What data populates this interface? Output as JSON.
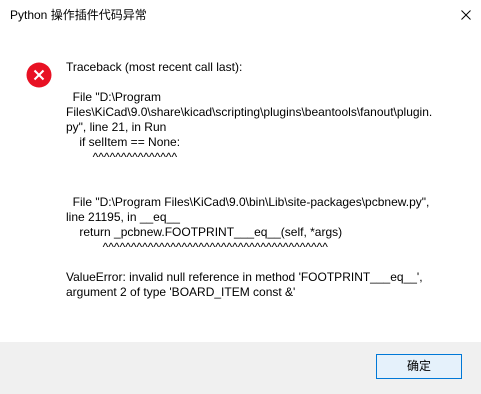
{
  "window": {
    "title": "Python 操作插件代码异常"
  },
  "icons": {
    "close": "close-icon",
    "error": "error-icon"
  },
  "colors": {
    "error_red": "#e81123",
    "accent": "#0078d7",
    "footer_bg": "#f0f0f0"
  },
  "message": {
    "lines": [
      "Traceback (most recent call last):",
      "",
      "  File \"D:\\Program",
      "Files\\KiCad\\9.0\\share\\kicad\\scripting\\plugins\\beantools\\fanout\\plugin.",
      "py\", line 21, in Run",
      "    if selItem == None:",
      "        ^^^^^^^^^^^^^^^",
      "",
      "",
      "  File \"D:\\Program Files\\KiCad\\9.0\\bin\\Lib\\site-packages\\pcbnew.py\",",
      "line 21195, in __eq__",
      "    return _pcbnew.FOOTPRINT___eq__(self, *args)",
      "           ^^^^^^^^^^^^^^^^^^^^^^^^^^^^^^^^^^^^^^^^",
      "",
      "ValueError: invalid null reference in method 'FOOTPRINT___eq__',",
      "argument 2 of type 'BOARD_ITEM const &'"
    ]
  },
  "buttons": {
    "ok_label": "确定"
  }
}
